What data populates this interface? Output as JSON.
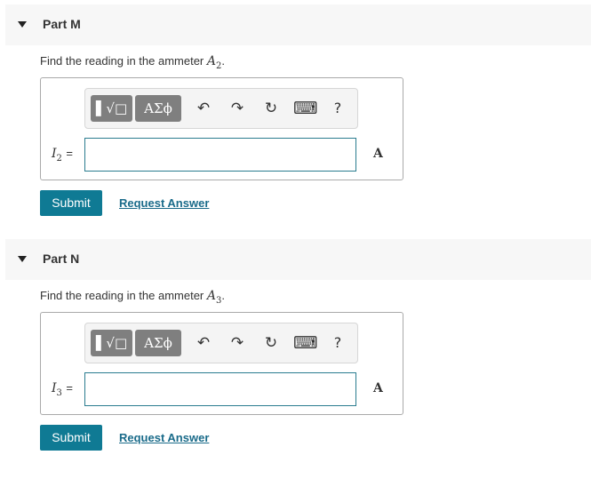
{
  "parts": [
    {
      "title": "Part M",
      "question_text": "Find the reading in the ammeter ",
      "question_var": "A",
      "question_sub": "2",
      "question_end": ".",
      "answer_var": "I",
      "answer_sub": "2",
      "equals": "=",
      "answer_value": "",
      "unit": "A",
      "submit_label": "Submit",
      "request_label": "Request Answer"
    },
    {
      "title": "Part N",
      "question_text": "Find the reading in the ammeter ",
      "question_var": "A",
      "question_sub": "3",
      "question_end": ".",
      "answer_var": "I",
      "answer_sub": "3",
      "equals": "=",
      "answer_value": "",
      "unit": "A",
      "submit_label": "Submit",
      "request_label": "Request Answer"
    }
  ],
  "toolbar": {
    "templates_label": "▌√□",
    "symbols_label": "ΑΣϕ",
    "undo_icon": "↶",
    "redo_icon": "↷",
    "reset_icon": "↻",
    "keyboard_icon": "⌨",
    "help_label": "?"
  }
}
